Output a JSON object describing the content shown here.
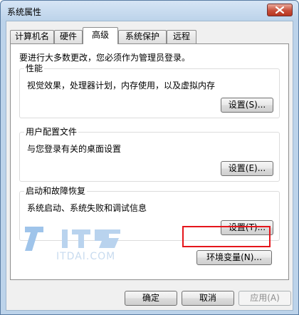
{
  "window": {
    "title": "系统属性"
  },
  "tabs": [
    {
      "label": "计算机名"
    },
    {
      "label": "硬件"
    },
    {
      "label": "高级"
    },
    {
      "label": "系统保护"
    },
    {
      "label": "远程"
    }
  ],
  "active_tab": "高级",
  "notice": "要进行大多数更改，您必须作为管理员登录。",
  "performance": {
    "label": "性能",
    "description": "视觉效果，处理器计划，内存使用，以及虚拟内存",
    "button": "设置(S)..."
  },
  "user_profiles": {
    "label": "用户配置文件",
    "description": "与您登录有关的桌面设置",
    "button": "设置(E)..."
  },
  "startup_recovery": {
    "label": "启动和故障恢复",
    "description": "系统启动、系统失败和调试信息",
    "button": "设置(T)..."
  },
  "env_button": "环境变量(N)...",
  "footer": {
    "ok": "确定",
    "cancel": "取消",
    "apply": "应用(A)"
  },
  "watermark": {
    "text": "ITDAI.COM",
    "logo": "IT袋"
  },
  "colors": {
    "highlight": "#e5151b",
    "frame": "#bcd3ea",
    "close": "#c74f3b"
  }
}
